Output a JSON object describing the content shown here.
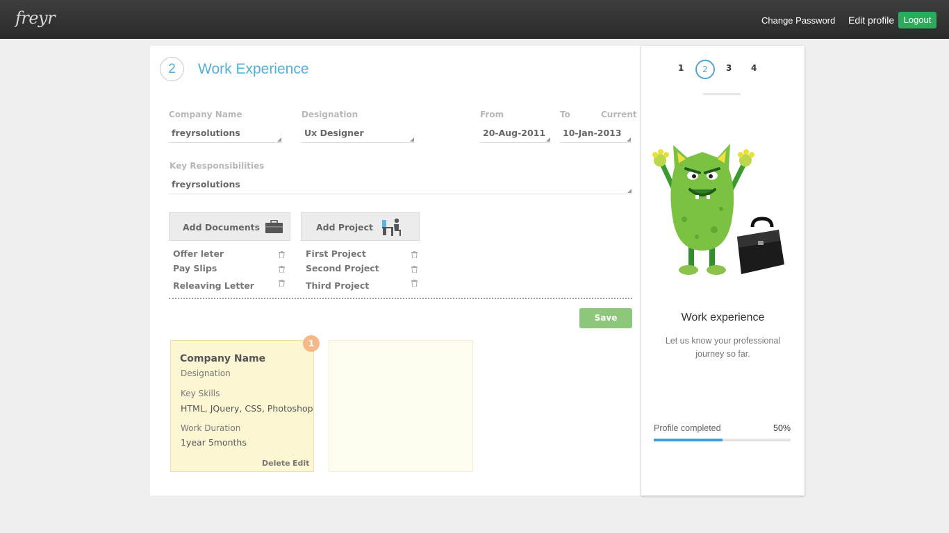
{
  "header": {
    "logo": "freyr",
    "change_password": "Change Password",
    "edit_profile": "Edit profile",
    "logout": "Logout"
  },
  "section": {
    "step": "2",
    "title": "Work Experience"
  },
  "form": {
    "company_label": "Company Name",
    "company_value": "freyrsolutions",
    "designation_label": "Designation",
    "designation_value": "Ux Designer",
    "from_label": "From",
    "from_value": "20-Aug-2011",
    "to_label": "To",
    "to_value": "10-Jan-2013",
    "current_label": "Current",
    "responsibilities_label": "Key Responsibilities",
    "responsibilities_value": "freyrsolutions"
  },
  "documents": {
    "button_label": "Add Documents",
    "items": [
      "Offer leter",
      "Pay Slips",
      "Releaving Letter"
    ]
  },
  "projects": {
    "button_label": "Add Project",
    "items": [
      "First Project",
      "Second Project",
      "Third Project"
    ]
  },
  "save_label": "Save",
  "experience_card": {
    "badge": "1",
    "company": "Company Name",
    "designation": "Designation",
    "skills_label": "Key Skills",
    "skills": "HTML, JQuery, CSS, Photoshop",
    "duration_label": "Work Duration",
    "duration": "1year 5months",
    "delete_label": "Delete",
    "edit_label": "Edit"
  },
  "sidebar": {
    "steps": [
      "1",
      "2",
      "3",
      "4"
    ],
    "active_step": "2",
    "title": "Work experience",
    "description": "Let us know your professional journey so far.",
    "progress_label": "Profile completed",
    "progress_text": "50%",
    "progress_fraction": 0.5
  },
  "colors": {
    "accent": "#4fb0d8",
    "logout": "#2eaa5c",
    "save": "#8dc87a",
    "card": "#fdf6d3",
    "badge": "#f5b987",
    "progress": "#3aa0cf"
  }
}
